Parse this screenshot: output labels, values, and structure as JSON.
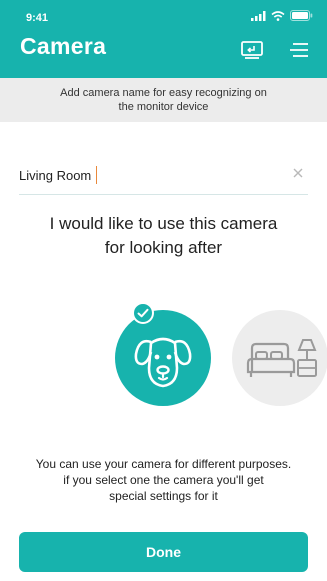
{
  "status_bar": {
    "time": "9:41",
    "icons": [
      "signal-icon",
      "wifi-icon",
      "battery-icon"
    ]
  },
  "header": {
    "title": "Camera",
    "icons": [
      "monitor-icon",
      "menu-icon"
    ]
  },
  "notice": {
    "text": "Add camera name for easy recognizing on the monitor device"
  },
  "camera_name": {
    "value": "Living Room",
    "clear_icon": "close-icon"
  },
  "question": {
    "line1": "I would like to use this camera",
    "line2": "for looking after"
  },
  "purposes": [
    {
      "icon": "dog-icon",
      "selected": true
    },
    {
      "icon": "bed-icon",
      "selected": false
    }
  ],
  "explanation": {
    "line1": "You can use your camera for different purposes.",
    "line2": "if you select one the camera you'll get",
    "line3": "special settings for it"
  },
  "done_button": {
    "label": "Done"
  },
  "colors": {
    "accent": "#17b3ad",
    "notice_bg": "#ececec",
    "unselected_bg": "#ededed",
    "caret": "#e9893b"
  }
}
